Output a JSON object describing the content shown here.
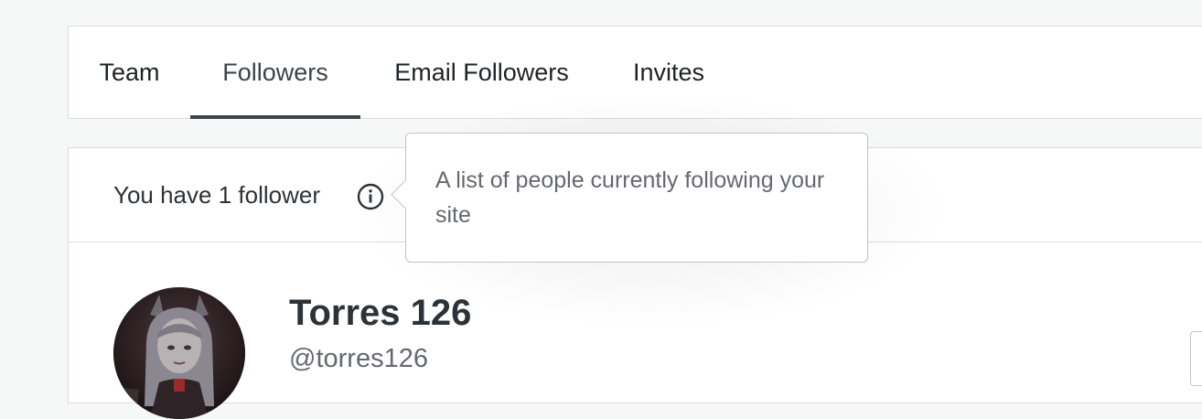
{
  "tabs": [
    {
      "label": "Team",
      "selected": false
    },
    {
      "label": "Followers",
      "selected": true
    },
    {
      "label": "Email Followers",
      "selected": false
    },
    {
      "label": "Invites",
      "selected": false
    }
  ],
  "header": {
    "follower_count_text": "You have 1 follower",
    "info_icon": "info-icon"
  },
  "tooltip": {
    "text": "A list of people currently following your site"
  },
  "followers": [
    {
      "name": "Torres 126",
      "handle": "@torres126",
      "avatar_icon": "avatar-image"
    }
  ],
  "colors": {
    "page_background": "#f6f7f7",
    "card_border": "#dcdcde",
    "selected_tab_indicator": "#3c434a",
    "muted_text": "#646970"
  }
}
